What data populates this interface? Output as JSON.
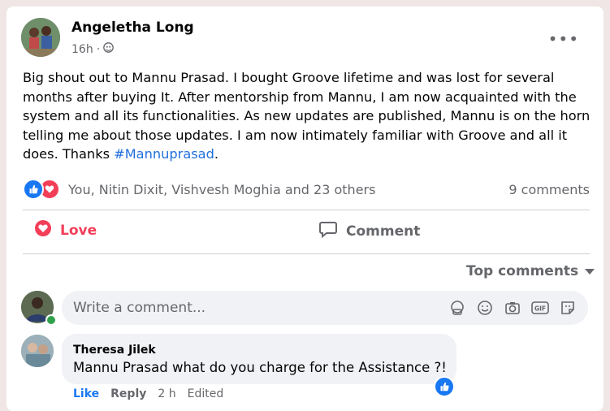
{
  "post": {
    "author": "Angeletha Long",
    "time": "16h",
    "separator": "·",
    "more_label": "•••",
    "text_main": "Big shout out to Mannu Prasad. I bought Groove lifetime and was lost for several months after buying It. After mentorship from Mannu, I am now acquainted with the system and all its functionalities. As new updates are published, Mannu is on the horn telling me about those updates. I am now intimately familiar with Groove and all it does. Thanks ",
    "hashtag": "#Mannuprasad",
    "text_end": "."
  },
  "reactions": {
    "summary": "You, Nitin Dixit, Vishvesh Moghia and 23 others",
    "comments_count": "9 comments"
  },
  "actions": {
    "love_label": "Love",
    "comment_label": "Comment"
  },
  "sort": {
    "label": "Top comments"
  },
  "composer": {
    "placeholder": "Write a comment..."
  },
  "comment": {
    "author": "Theresa Jilek",
    "text": "Mannu Prasad what do you charge for the Assistance ?!",
    "like_label": "Like",
    "reply_label": "Reply",
    "time": "2 h",
    "edited_label": "Edited"
  },
  "colors": {
    "like_blue": "#1877f2",
    "love_red": "#f33e58",
    "hashtag_blue": "#216fdb",
    "secondary_text": "#65676b",
    "online_green": "#31a24c"
  }
}
